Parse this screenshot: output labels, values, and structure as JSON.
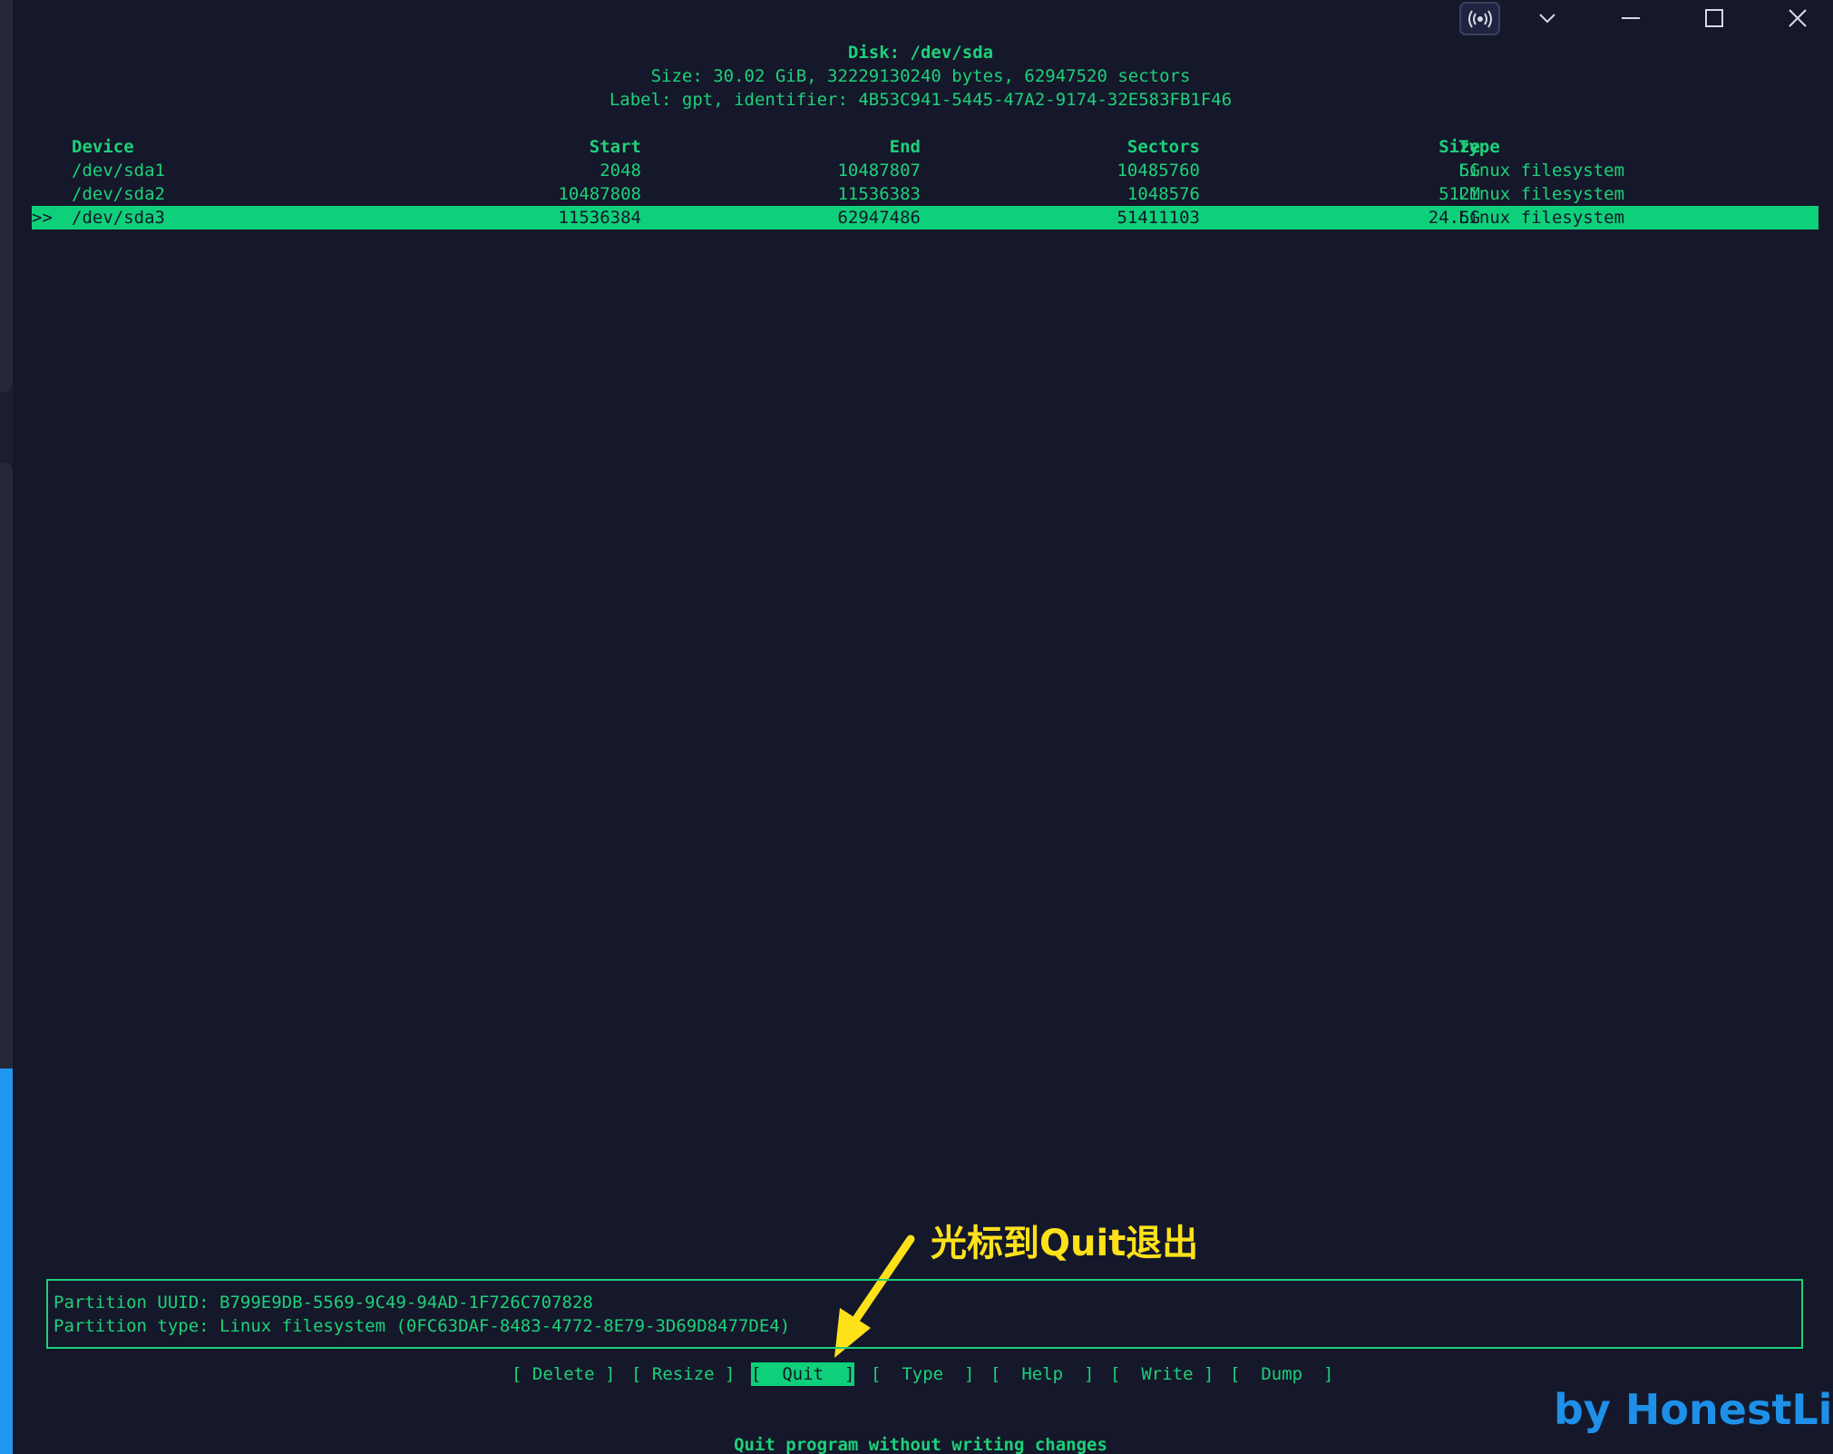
{
  "window": {
    "broadcast_icon": "broadcast-icon",
    "dropdown_icon": "chevron-down-icon",
    "minimize_icon": "minimize-icon",
    "maximize_icon": "maximize-icon",
    "close_icon": "close-icon"
  },
  "disk": {
    "title": "Disk: /dev/sda",
    "size_line": "Size: 30.02 GiB, 32229130240 bytes, 62947520 sectors",
    "label_line": "Label: gpt, identifier: 4B53C941-5445-47A2-9174-32E583FB1F46"
  },
  "table": {
    "headers": {
      "device": "Device",
      "start": "Start",
      "end": "End",
      "sectors": "Sectors",
      "size": "Size",
      "type": "Type"
    },
    "rows": [
      {
        "marker": "",
        "device": "/dev/sda1",
        "start": "2048",
        "end": "10487807",
        "sectors": "10485760",
        "size": "5G",
        "type": "Linux filesystem"
      },
      {
        "marker": "",
        "device": "/dev/sda2",
        "start": "10487808",
        "end": "11536383",
        "sectors": "1048576",
        "size": "512M",
        "type": "Linux filesystem"
      },
      {
        "marker": ">>",
        "device": "/dev/sda3",
        "start": "11536384",
        "end": "62947486",
        "sectors": "51411103",
        "size": "24.5G",
        "type": "Linux filesystem"
      }
    ]
  },
  "info": {
    "uuid_line": "Partition UUID: B799E9DB-5569-9C49-94AD-1F726C707828",
    "type_line": "Partition type: Linux filesystem (0FC63DAF-8483-4772-8E79-3D69D8477DE4)"
  },
  "menu": {
    "delete": "[ Delete ]",
    "resize": "[ Resize ]",
    "quit": "[  Quit  ]",
    "type": "[  Type  ]",
    "help": "[  Help  ]",
    "write": "[  Write ]",
    "dump": "[  Dump  ]"
  },
  "status": "Quit program without writing changes",
  "annotation": {
    "text": "光标到Quit退出",
    "color": "#ffe11a"
  },
  "watermark": "by HonestLiu",
  "colors": {
    "terminal_bg": "#14182a",
    "terminal_fg": "#1ed07a",
    "selection": "#0fd07a",
    "watermark": "#1e90e8"
  }
}
